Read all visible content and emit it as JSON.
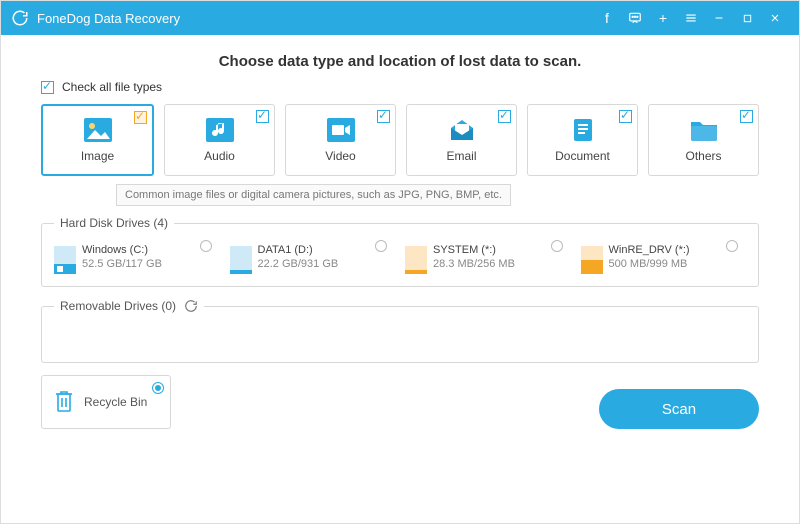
{
  "titlebar": {
    "app_name": "FoneDog Data Recovery"
  },
  "heading": "Choose data type and location of lost data to scan.",
  "check_all_label": "Check all file types",
  "types": {
    "image": "Image",
    "audio": "Audio",
    "video": "Video",
    "email": "Email",
    "document": "Document",
    "others": "Others"
  },
  "tooltip": "Common image files or digital camera pictures, such as JPG, PNG, BMP, etc.",
  "sections": {
    "hdd_title": "Hard Disk Drives (4)",
    "removable_title": "Removable Drives (0)"
  },
  "drives": [
    {
      "name": "Windows (C:)",
      "size": "52.5 GB/117 GB",
      "fill": 45,
      "color": "#66b8e8"
    },
    {
      "name": "DATA1 (D:)",
      "size": "22.2 GB/931 GB",
      "fill": 3,
      "color": "#66b8e8"
    },
    {
      "name": "SYSTEM (*:)",
      "size": "28.3 MB/256 MB",
      "fill": 11,
      "color": "#f5a623"
    },
    {
      "name": "WinRE_DRV (*:)",
      "size": "500 MB/999 MB",
      "fill": 50,
      "color": "#f5a623"
    }
  ],
  "recycle_label": "Recycle Bin",
  "scan_label": "Scan"
}
